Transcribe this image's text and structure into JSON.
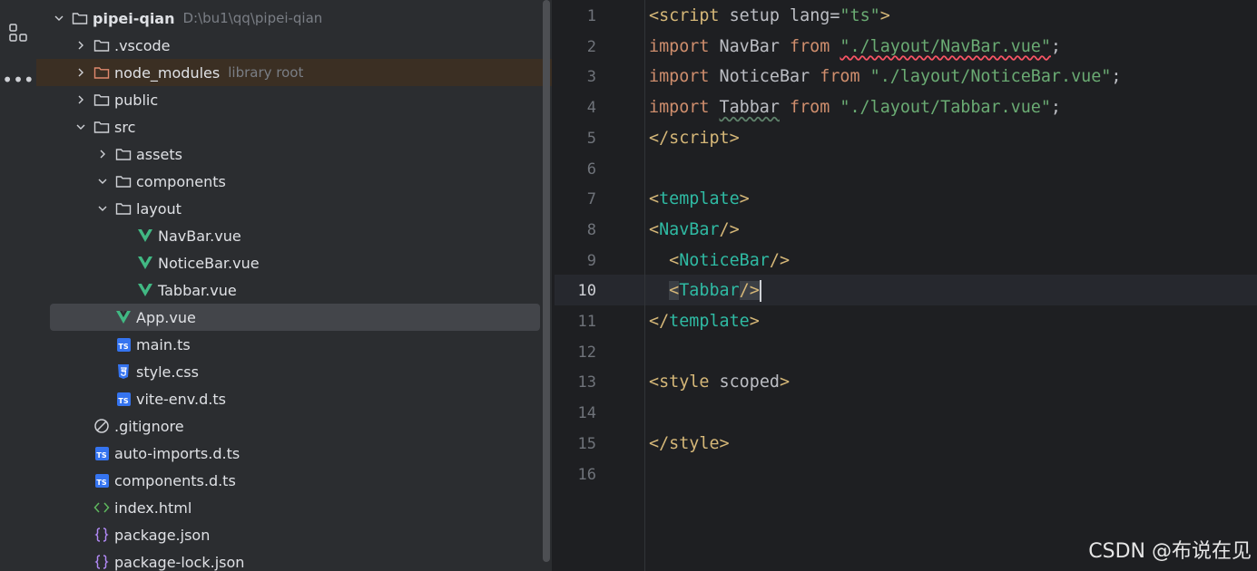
{
  "activity": {
    "structure_icon": "structure-icon",
    "more_icon": "more-horizontal-icon",
    "more_label": "•••"
  },
  "tree": {
    "rows": [
      {
        "label": "pipei-qian",
        "hint": "D:\\bu1\\qq\\pipei-qian",
        "type": "folder",
        "expanded": true,
        "depth": 0
      },
      {
        "label": ".vscode",
        "type": "folder",
        "expanded": false,
        "depth": 1
      },
      {
        "label": "node_modules",
        "hint": "library root",
        "type": "folder-lib",
        "expanded": false,
        "depth": 1
      },
      {
        "label": "public",
        "type": "folder",
        "expanded": false,
        "depth": 1
      },
      {
        "label": "src",
        "type": "folder",
        "expanded": true,
        "depth": 1
      },
      {
        "label": "assets",
        "type": "folder",
        "expanded": false,
        "depth": 2
      },
      {
        "label": "components",
        "type": "folder",
        "expanded": true,
        "depth": 2
      },
      {
        "label": "layout",
        "type": "folder",
        "expanded": true,
        "depth": 2
      },
      {
        "label": "NavBar.vue",
        "type": "vue",
        "depth": 3
      },
      {
        "label": "NoticeBar.vue",
        "type": "vue",
        "depth": 3
      },
      {
        "label": "Tabbar.vue",
        "type": "vue",
        "depth": 3
      },
      {
        "label": "App.vue",
        "type": "vue",
        "depth": 2,
        "selected": true
      },
      {
        "label": "main.ts",
        "type": "ts",
        "depth": 2
      },
      {
        "label": "style.css",
        "type": "css",
        "depth": 2
      },
      {
        "label": "vite-env.d.ts",
        "type": "ts",
        "depth": 2
      },
      {
        "label": ".gitignore",
        "type": "ignore",
        "depth": 1
      },
      {
        "label": "auto-imports.d.ts",
        "type": "ts",
        "depth": 1
      },
      {
        "label": "components.d.ts",
        "type": "ts",
        "depth": 1
      },
      {
        "label": "index.html",
        "type": "html",
        "depth": 1
      },
      {
        "label": "package.json",
        "type": "json",
        "depth": 1
      },
      {
        "label": "package-lock.json",
        "type": "json",
        "depth": 1
      }
    ],
    "ts_badge": "TS"
  },
  "editor": {
    "current_line": 10,
    "line_numbers": [
      "1",
      "2",
      "3",
      "4",
      "5",
      "6",
      "7",
      "8",
      "9",
      "10",
      "11",
      "12",
      "13",
      "14",
      "15",
      "16"
    ],
    "lines": [
      {
        "t": "<script",
        "k": "setup",
        "a": "lang",
        "eq": "=",
        "v": "\"ts\"",
        "c": ">"
      },
      {
        "kw": "import",
        "id": "NavBar",
        "from": "from",
        "str": "\"./layout/NavBar.vue\"",
        "end": ";"
      },
      {
        "kw": "import",
        "id": "NoticeBar",
        "from": "from",
        "str": "\"./layout/NoticeBar.vue\"",
        "end": ";"
      },
      {
        "kw": "import",
        "id": "Tabbar",
        "from": "from",
        "str": "\"./layout/Tabbar.vue\"",
        "end": ";"
      },
      {
        "open": "</",
        "name": "script",
        "close": ">"
      },
      {},
      {
        "open": "<",
        "name": "template",
        "close": ">"
      },
      {
        "open": "<",
        "name": "NavBar",
        "close": "/>"
      },
      {
        "indent": "  ",
        "open": "<",
        "name": "NoticeBar",
        "close": "/>"
      },
      {
        "indent": "  ",
        "open": "<",
        "name": "Tabbar",
        "close": "/>"
      },
      {
        "open": "</",
        "name": "template",
        "close": ">"
      },
      {},
      {
        "open": "<",
        "name": "style",
        "attr": "scoped",
        "close": ">"
      },
      {},
      {
        "open": "</",
        "name": "style",
        "close": ">"
      },
      {}
    ]
  },
  "watermark": "CSDN @布说在见",
  "colors": {
    "sidebar_bg": "#2b2d30",
    "editor_bg": "#1e1f22",
    "tag": "#d5b778",
    "component_tag": "#2fbaa3",
    "keyword": "#cf8e6d",
    "string": "#6aab73",
    "vue_green": "#41b883",
    "ts_blue": "#3574f0"
  }
}
